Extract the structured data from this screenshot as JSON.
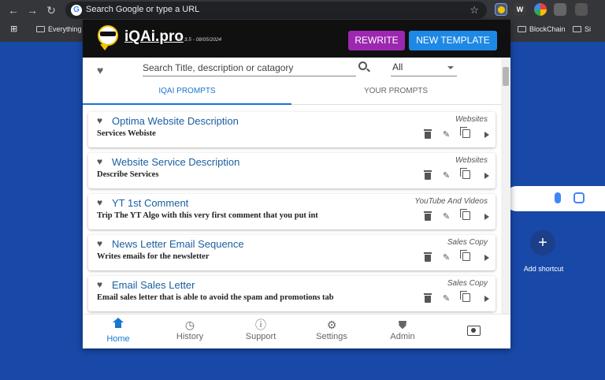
{
  "browser": {
    "omnibox_text": "Search Google or type a URL",
    "bookmarks": [
      {
        "label": "Everything"
      },
      {
        "label": "BlockChain"
      },
      {
        "label": "Si"
      }
    ]
  },
  "ntp": {
    "add_shortcut_label": "Add shortcut"
  },
  "popup": {
    "brand": "iQAi.pro",
    "version": "V: 3.5 - 08/05/2024",
    "rewrite_label": "REWRITE",
    "new_template_label": "NEW TEMPLATE",
    "search": {
      "placeholder": "Search Title, description or catagory",
      "category_value": "All"
    },
    "tabs": [
      {
        "label": "IQAI PROMPTS",
        "active": true
      },
      {
        "label": "YOUR PROMPTS",
        "active": false
      }
    ],
    "prompts": [
      {
        "title": "Optima Website Description",
        "category": "Websites",
        "description": "Services Webiste"
      },
      {
        "title": "Website Service Description",
        "category": "Websites",
        "description": "Describe Services"
      },
      {
        "title": "YT 1st Comment",
        "category": "YouTube And Videos",
        "description": "Trip The YT Algo with this very first comment that you put int"
      },
      {
        "title": "News Letter Email Sequence",
        "category": "Sales Copy",
        "description": "Writes emails for the newsletter"
      },
      {
        "title": "Email Sales Letter",
        "category": "Sales Copy",
        "description": "Email sales letter that is able to avoid the spam and promotions tab"
      }
    ],
    "nav": [
      {
        "label": "Home",
        "active": true
      },
      {
        "label": "History"
      },
      {
        "label": "Support"
      },
      {
        "label": "Settings"
      },
      {
        "label": "Admin"
      }
    ]
  },
  "colors": {
    "accent": "#1976d2",
    "rewrite": "#9c27b0",
    "new_template": "#1e88e5",
    "header": "#101010",
    "background": "#1848a8"
  }
}
